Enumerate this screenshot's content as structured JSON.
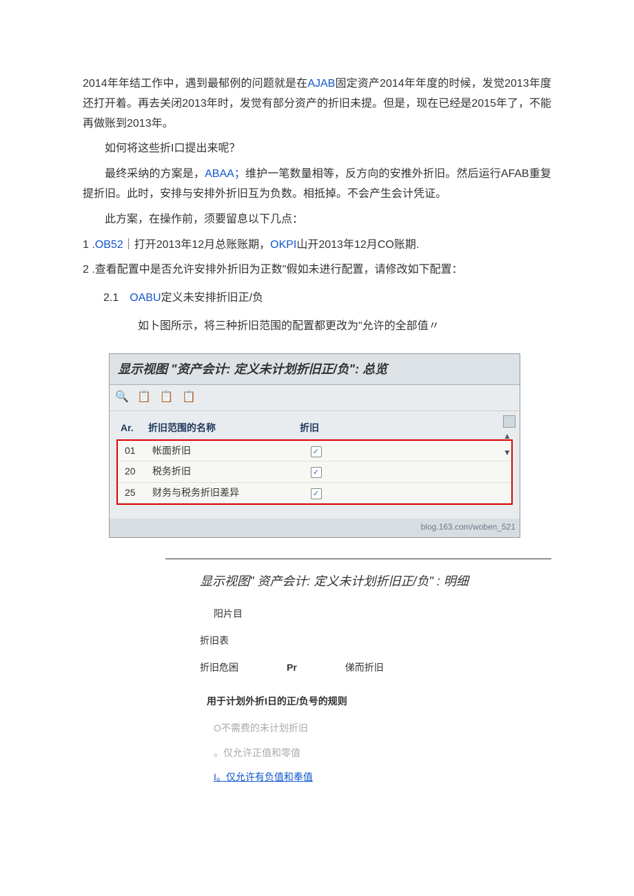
{
  "paragraphs": {
    "p1_a": "2014年年结工作中，遇到最郁例的问题就是在",
    "p1_link1": "AJAB",
    "p1_b": "固定资产2014年年度的时候，发觉2013年度还打开着。再去关闭2013年时，发觉有部分资产的折旧未提。但是，现在已经是2015年了，不能再做账到2013年。",
    "p2": "如何将这些折I口提出来呢？",
    "p3_a": "最终采纳的方案是，",
    "p3_link": "ABAA；",
    "p3_b": "维护一笔数量相等，反方向的安推外折旧。然后运行AFAB重复提折旧。此时，安排与安排外折旧互为负数。相抵掉。不会产生会计凭证。",
    "p4": "此方案，在操作前，须要留息以下几点：",
    "item1_a": "1 .",
    "item1_link1": "OB52",
    "item1_b": "｜打开2013年12月总账账期，",
    "item1_link2": "OKPI",
    "item1_c": "山开2013年12月CO账期.",
    "item2": "2 .查看配置中是否允许安排外折旧为正数\"假如未进行配置，请修改如下配置：",
    "sub21_a": "2.1　",
    "sub21_link": "OABU",
    "sub21_b": "定义未安排折旧正/负",
    "sub21_desc": "如卜图所示，将三种折旧范围的配置都更改为\"允许的全部值〃"
  },
  "sap_screen1": {
    "title": "显示视图 \"资产会计: 定义未计划折旧正/负\": 总览",
    "toolbar_icons": "🔍 📋 📋 📋",
    "headers": {
      "ar": "Ar.",
      "name": "折旧范围的名称",
      "dep": "折旧"
    },
    "rows": [
      {
        "ar": "01",
        "name": "帐面折旧"
      },
      {
        "ar": "20",
        "name": "税务折旧"
      },
      {
        "ar": "25",
        "name": "财务与税务折旧差异"
      }
    ],
    "footer": "blog.163.com/woben_521"
  },
  "sap_screen2": {
    "title": "显示视图\" 资产会计: 定义未计划折旧正/负\" : 明细",
    "line1": "阳片目",
    "label1": "折旧表",
    "row2": {
      "l1": "折旧危困",
      "l2": "Pr",
      "l3": "俤而折旧"
    },
    "rule_header": "用于计划外折I日的正/负号的规则",
    "opt1": "O不需费的未计划折旧",
    "opt2": "。仅允许正值和零值",
    "opt3": "I。仅允许有负值和奉值"
  }
}
